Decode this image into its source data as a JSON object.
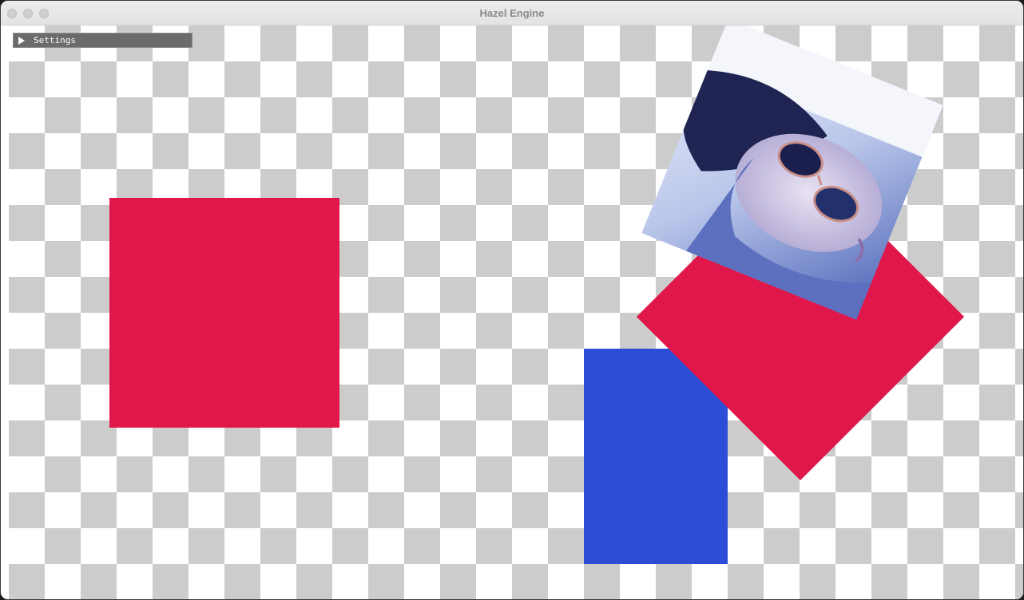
{
  "window": {
    "title": "Hazel Engine"
  },
  "settings": {
    "label": "Settings"
  },
  "colors": {
    "red": "#e0174a",
    "blue": "#2c4ed6",
    "checker_light": "#ffffff",
    "checker_dark": "#cccccc",
    "panel": "#6b6b6b"
  },
  "icons": {
    "settings_toggle": "triangle-right-icon"
  }
}
